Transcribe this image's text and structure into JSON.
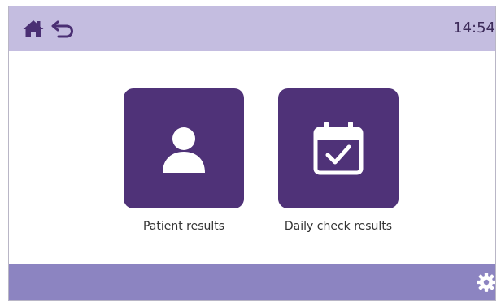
{
  "header": {
    "time": "14:54",
    "home_icon": "home-icon",
    "back_icon": "back-arrow-icon"
  },
  "tiles": [
    {
      "label": "Patient results",
      "icon": "person-icon"
    },
    {
      "label": "Daily check results",
      "icon": "calendar-check-icon"
    }
  ],
  "footer": {
    "settings_icon": "gear-icon"
  },
  "colors": {
    "topbar": "#c4bde0",
    "tile": "#4f3278",
    "bottombar": "#8c84c1",
    "icon_dark": "#4a2f73"
  }
}
